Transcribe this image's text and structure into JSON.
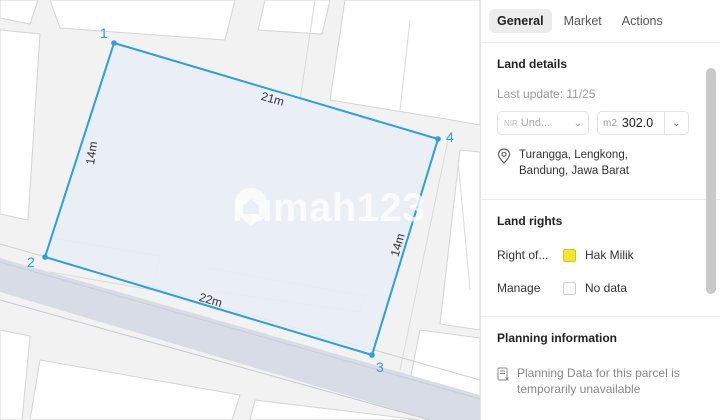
{
  "map": {
    "parcel": {
      "vertices": [
        {
          "label": "1"
        },
        {
          "label": "2"
        },
        {
          "label": "3"
        },
        {
          "label": "4"
        }
      ],
      "edges": [
        "21m",
        "14m",
        "22m",
        "14m"
      ]
    },
    "watermark": "rumah123",
    "colors": {
      "parcel_stroke": "#2b9ee6",
      "parcel_fill": "#e8eef4",
      "road": "#d8dce6"
    }
  },
  "panel": {
    "tabs": [
      {
        "label": "General",
        "active": true
      },
      {
        "label": "Market",
        "active": false
      },
      {
        "label": "Actions",
        "active": false
      }
    ],
    "land_details": {
      "title": "Land details",
      "last_update": "Last update: 11/25",
      "nir_prefix": "NIR",
      "nir_value": "Und...",
      "area_unit": "m2",
      "area_value": "302.0",
      "address": "Turangga, Lengkong, Bandung, Jawa Barat"
    },
    "land_rights": {
      "title": "Land rights",
      "rows": [
        {
          "label": "Right of...",
          "value": "Hak Milik",
          "swatch": "#f7e52d"
        },
        {
          "label": "Manage",
          "value": "No data",
          "swatch": "#ffffff"
        }
      ]
    },
    "planning": {
      "title": "Planning information",
      "note": "Planning Data for this parcel is temporarily unavailable"
    }
  }
}
